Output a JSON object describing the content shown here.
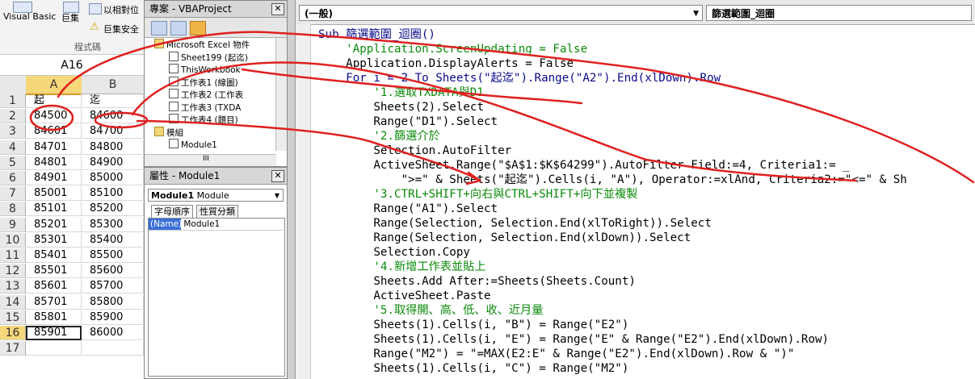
{
  "ribbon": {
    "visual_basic_label": "Visual Basic",
    "macros_label": "巨集",
    "relative_ref_label": "以相對位",
    "macro_security_label": "巨集安全",
    "group_label": "程式碼"
  },
  "name_box": {
    "value": "A16"
  },
  "sheet": {
    "columns": [
      "A",
      "B"
    ],
    "rows": [
      {
        "n": "1",
        "a": "起",
        "b": "迄"
      },
      {
        "n": "2",
        "a": "84500",
        "b": "84600"
      },
      {
        "n": "3",
        "a": "84601",
        "b": "84700"
      },
      {
        "n": "4",
        "a": "84701",
        "b": "84800"
      },
      {
        "n": "5",
        "a": "84801",
        "b": "84900"
      },
      {
        "n": "6",
        "a": "84901",
        "b": "85000"
      },
      {
        "n": "7",
        "a": "85001",
        "b": "85100"
      },
      {
        "n": "8",
        "a": "85101",
        "b": "85200"
      },
      {
        "n": "9",
        "a": "85201",
        "b": "85300"
      },
      {
        "n": "10",
        "a": "85301",
        "b": "85400"
      },
      {
        "n": "11",
        "a": "85401",
        "b": "85500"
      },
      {
        "n": "12",
        "a": "85501",
        "b": "85600"
      },
      {
        "n": "13",
        "a": "85601",
        "b": "85700"
      },
      {
        "n": "14",
        "a": "85701",
        "b": "85800"
      },
      {
        "n": "15",
        "a": "85801",
        "b": "85900"
      },
      {
        "n": "16",
        "a": "85901",
        "b": "86000"
      },
      {
        "n": "17",
        "a": "",
        "b": ""
      }
    ]
  },
  "project": {
    "title": "專案 - VBAProject",
    "close": "✕",
    "tree": [
      "Microsoft Excel 物件",
      "Sheet199 (起迄)",
      "ThisWorkbook",
      "工作表1 (線圖)",
      "工作表2 (工作表",
      "工作表3 (TXDA",
      "工作表4 (題目)",
      "模組",
      "Module1"
    ],
    "hscroll_grip": "III"
  },
  "properties": {
    "title": "屬性 - Module1",
    "close": "✕",
    "object_name": "Module1",
    "object_type": "Module",
    "tab_alpha": "字母順序",
    "tab_category": "性質分類",
    "prop_key": "(Name)",
    "prop_value": "Module1"
  },
  "code": {
    "object_combo": "(一般)",
    "proc_combo": "篩選範圍_迴圈",
    "lines": [
      {
        "t": "Sub 篩選範圍_迴圈()",
        "c": "kw"
      },
      {
        "t": "    'Application.ScreenUpdating = False",
        "c": "cm"
      },
      {
        "t": "    Application.DisplayAlerts = False",
        "c": "tx"
      },
      {
        "t": "    For i = 2 To Sheets(\"起迄\").Range(\"A2\").End(xlDown).Row",
        "c": "kw"
      },
      {
        "t": "        '1.選取TXDATA與D1",
        "c": "cm"
      },
      {
        "t": "        Sheets(2).Select",
        "c": "tx"
      },
      {
        "t": "        Range(\"D1\").Select",
        "c": "tx"
      },
      {
        "t": "        '2.篩選介於",
        "c": "cm"
      },
      {
        "t": "        Selection.AutoFilter",
        "c": "tx"
      },
      {
        "t": "        ActiveSheet.Range(\"$A$1:$K$64299\").AutoFilter Field:=4, Criteria1:= _",
        "c": "tx"
      },
      {
        "t": "            \">=\" & Sheets(\"起迄\").Cells(i, \"A\"), Operator:=xlAnd, Criteria2:=\"<=\" & Sh",
        "c": "tx"
      },
      {
        "t": "        '3.CTRL+SHIFT+向右與CTRL+SHIFT+向下並複製",
        "c": "cm"
      },
      {
        "t": "        Range(\"A1\").Select",
        "c": "tx"
      },
      {
        "t": "        Range(Selection, Selection.End(xlToRight)).Select",
        "c": "tx"
      },
      {
        "t": "        Range(Selection, Selection.End(xlDown)).Select",
        "c": "tx"
      },
      {
        "t": "        Selection.Copy",
        "c": "tx"
      },
      {
        "t": "        '4.新增工作表並貼上",
        "c": "cm"
      },
      {
        "t": "        Sheets.Add After:=Sheets(Sheets.Count)",
        "c": "tx"
      },
      {
        "t": "        ActiveSheet.Paste",
        "c": "tx"
      },
      {
        "t": "        '5.取得開、高、低、收、近月量",
        "c": "cm"
      },
      {
        "t": "        Sheets(1).Cells(i, \"B\") = Range(\"E2\")",
        "c": "tx"
      },
      {
        "t": "        Sheets(1).Cells(i, \"E\") = Range(\"E\" & Range(\"E2\").End(xlDown).Row)",
        "c": "tx"
      },
      {
        "t": "        Range(\"M2\") = \"=MAX(E2:E\" & Range(\"E2\").End(xlDown).Row & \")\"",
        "c": "tx"
      },
      {
        "t": "        Sheets(1).Cells(i, \"C\") = Range(\"M2\")",
        "c": "tx"
      }
    ]
  },
  "colors": {
    "annotation": "#e02020",
    "keyword": "#0a0a8a",
    "comment": "#0a8a0a"
  }
}
